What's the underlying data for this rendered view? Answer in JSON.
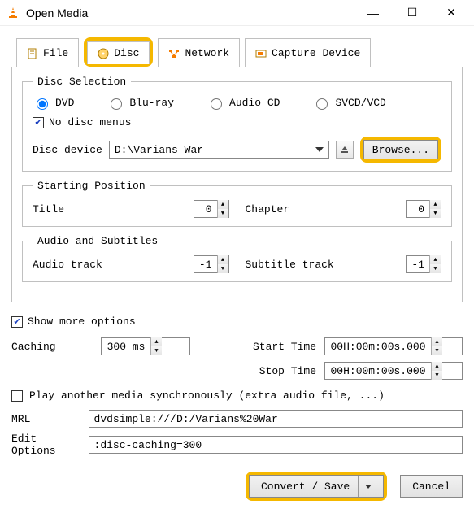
{
  "window": {
    "title": "Open Media"
  },
  "tabs": {
    "file": "File",
    "disc": "Disc",
    "network": "Network",
    "capture": "Capture Device"
  },
  "disc_selection": {
    "legend": "Disc Selection",
    "dvd": "DVD",
    "bluray": "Blu-ray",
    "audio_cd": "Audio CD",
    "svcd": "SVCD/VCD",
    "no_menus": "No disc menus",
    "device_label": "Disc device",
    "device_value": "D:\\Varians War",
    "browse": "Browse..."
  },
  "starting": {
    "legend": "Starting Position",
    "title_label": "Title",
    "title_value": "0",
    "chapter_label": "Chapter",
    "chapter_value": "0"
  },
  "audio_sub": {
    "legend": "Audio and Subtitles",
    "audio_label": "Audio track",
    "audio_value": "-1",
    "sub_label": "Subtitle track",
    "sub_value": "-1"
  },
  "options": {
    "show_more": "Show more options",
    "caching_label": "Caching",
    "caching_value": "300 ms",
    "start_label": "Start Time",
    "start_value": "00H:00m:00s.000",
    "stop_label": "Stop Time",
    "stop_value": "00H:00m:00s.000",
    "sync_label": "Play another media synchronously (extra audio file, ...)",
    "mrl_label": "MRL",
    "mrl_value": "dvdsimple:///D:/Varians%20War",
    "edit_label": "Edit Options",
    "edit_value": ":disc-caching=300"
  },
  "footer": {
    "convert": "Convert / Save",
    "cancel": "Cancel"
  }
}
